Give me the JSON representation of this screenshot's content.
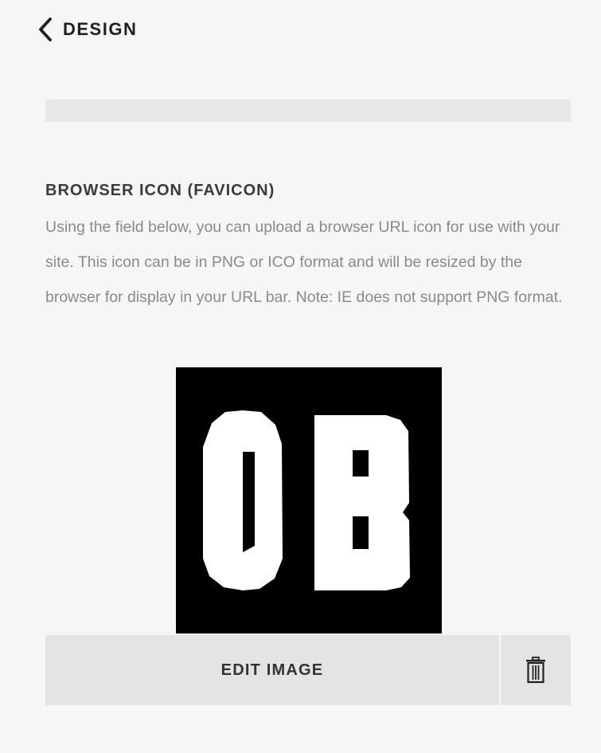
{
  "header": {
    "back_label": "DESIGN",
    "back_icon": "chevron-left-icon"
  },
  "favicon_section": {
    "heading": "BROWSER ICON (FAVICON)",
    "description": "Using the field below, you can upload a browser URL icon for use with your site. This icon can be in PNG or ICO format and will be resized by the browser for display in your URL bar. Note: IE does not support PNG format.",
    "preview_image_text": "OB",
    "preview_background": "#000000",
    "preview_foreground": "#ffffff"
  },
  "actions": {
    "edit_label": "EDIT IMAGE",
    "delete_icon": "trash-icon"
  }
}
